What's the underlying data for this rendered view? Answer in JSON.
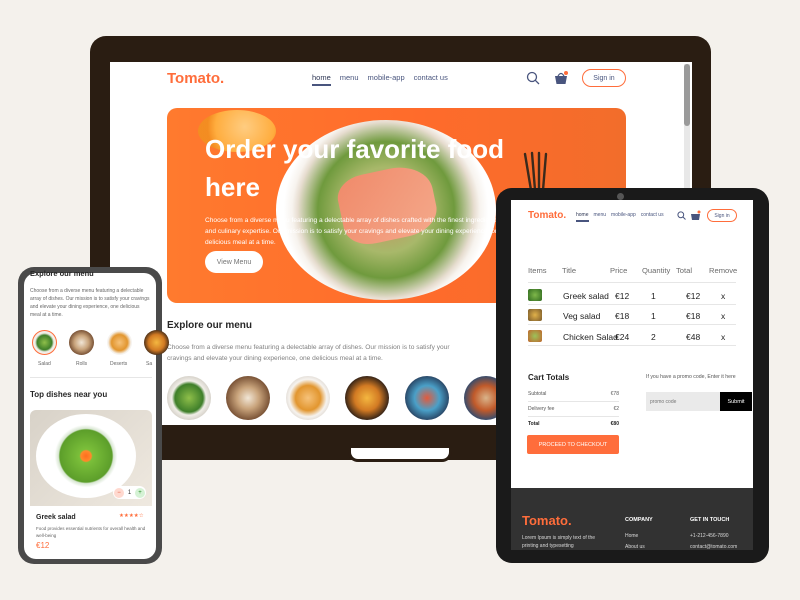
{
  "site": {
    "logo": "Tomato."
  },
  "laptop": {
    "nav": [
      "home",
      "menu",
      "mobile-app",
      "contact us"
    ],
    "signin": "Sign in",
    "hero": {
      "title": "Order your favorite food here",
      "desc": "Choose from a diverse menu featuring a delectable array of dishes crafted with the finest ingredients and culinary expertise. Our mission is to satisfy your cravings and elevate your dining experience, one delicious meal at a time.",
      "button": "View Menu"
    },
    "explore": {
      "title": "Explore our menu",
      "desc": "Choose from a diverse menu featuring a delectable array of dishes. Our mission is to satisfy your cravings and elevate your dining experience, one delicious meal at a time."
    }
  },
  "tablet": {
    "nav": [
      "home",
      "menu",
      "mobile-app",
      "contact us"
    ],
    "signin": "Sign in",
    "cart_headers": [
      "Items",
      "Title",
      "Price",
      "Quantity",
      "Total",
      "Remove"
    ],
    "cart_rows": [
      {
        "title": "Greek salad",
        "price": "€12",
        "qty": "1",
        "total": "€12",
        "remove": "x"
      },
      {
        "title": "Veg salad",
        "price": "€18",
        "qty": "1",
        "total": "€18",
        "remove": "x"
      },
      {
        "title": "Chicken Salad",
        "price": "€24",
        "qty": "2",
        "total": "€48",
        "remove": "x"
      }
    ],
    "totals": {
      "title": "Cart Totals",
      "subtotal_label": "Subtotal",
      "subtotal": "€78",
      "delivery_label": "Delivery fee",
      "delivery": "€2",
      "total_label": "Total",
      "total": "€80",
      "checkout": "PROCEED TO CHECKOUT"
    },
    "promo": {
      "text": "If you have a promo code, Enter it here",
      "placeholder": "promo code",
      "submit": "Submit"
    },
    "footer": {
      "company_title": "COMPANY",
      "company_links": [
        "Home",
        "About us"
      ],
      "contact_title": "GET IN TOUCH",
      "phone": "+1-212-456-7890",
      "email": "contact@tomato.com",
      "blurb": "Lorem Ipsum is simply text of the printing and typesetting"
    }
  },
  "phone": {
    "explore_title": "Explore our menu",
    "explore_desc": "Choose from a diverse menu featuring a delectable array of dishes. Our mission is to satisfy your cravings and elevate your dining experience, one delicious meal at a time.",
    "categories": [
      "Salad",
      "Rolls",
      "Deserts",
      "Sa"
    ],
    "top_title": "Top dishes near you",
    "dish": {
      "name": "Greek salad",
      "rating": "★★★★☆",
      "desc": "Food provides essential nutrients for overall health and well-being",
      "price": "€12",
      "qty": "1",
      "minus": "−",
      "plus": "+"
    }
  },
  "colors": {
    "accent": "#ff6d3b",
    "text": "#49557e",
    "device": "#2a1d12"
  },
  "icons": [
    "search-icon",
    "basket-icon",
    "fork-icon"
  ]
}
